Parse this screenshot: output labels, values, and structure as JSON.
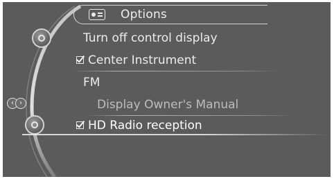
{
  "header": {
    "title": "Options",
    "icon": "radio-icon"
  },
  "menu": {
    "items": [
      {
        "label": "Turn off control display",
        "checked": false,
        "enabled": true
      },
      {
        "label": "Center Instrument",
        "checked": true,
        "enabled": true
      },
      {
        "label": "FM",
        "checked": false,
        "enabled": true
      },
      {
        "label": "Display Owner's Manual",
        "checked": false,
        "enabled": false
      },
      {
        "label": "HD Radio reception",
        "checked": true,
        "enabled": true,
        "selected": true
      }
    ]
  },
  "nav": {
    "left_icon": "chevron-left-icon",
    "right_icon": "chevron-right-icon"
  },
  "colors": {
    "background": "#5b5b5b",
    "text": "#ececec",
    "disabled_text": "#bdbdbd",
    "outline": "#d6d6d6"
  }
}
